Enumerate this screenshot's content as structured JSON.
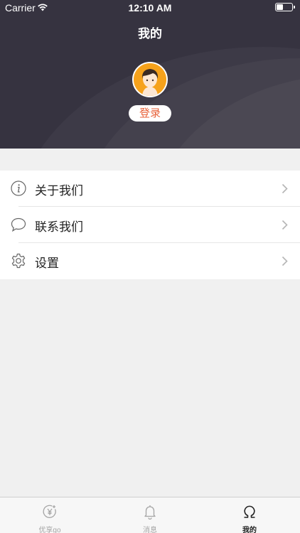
{
  "status_bar": {
    "carrier": "Carrier",
    "time": "12:10 AM"
  },
  "nav": {
    "title": "我的"
  },
  "profile": {
    "login_label": "登录"
  },
  "menu": {
    "items": [
      {
        "label": "关于我们",
        "icon": "info-icon"
      },
      {
        "label": "联系我们",
        "icon": "chat-bubble-icon"
      },
      {
        "label": "设置",
        "icon": "gear-icon"
      }
    ]
  },
  "tabbar": {
    "tabs": [
      {
        "label": "优享go",
        "icon": "yen-coin-icon",
        "active": false
      },
      {
        "label": "消息",
        "icon": "bell-icon",
        "active": false
      },
      {
        "label": "我的",
        "icon": "omega-icon",
        "active": true
      }
    ]
  },
  "colors": {
    "header_bg": "#363340",
    "accent": "#e8623a",
    "avatar_bg": "#f6a21b",
    "page_bg": "#f0f0f0"
  }
}
